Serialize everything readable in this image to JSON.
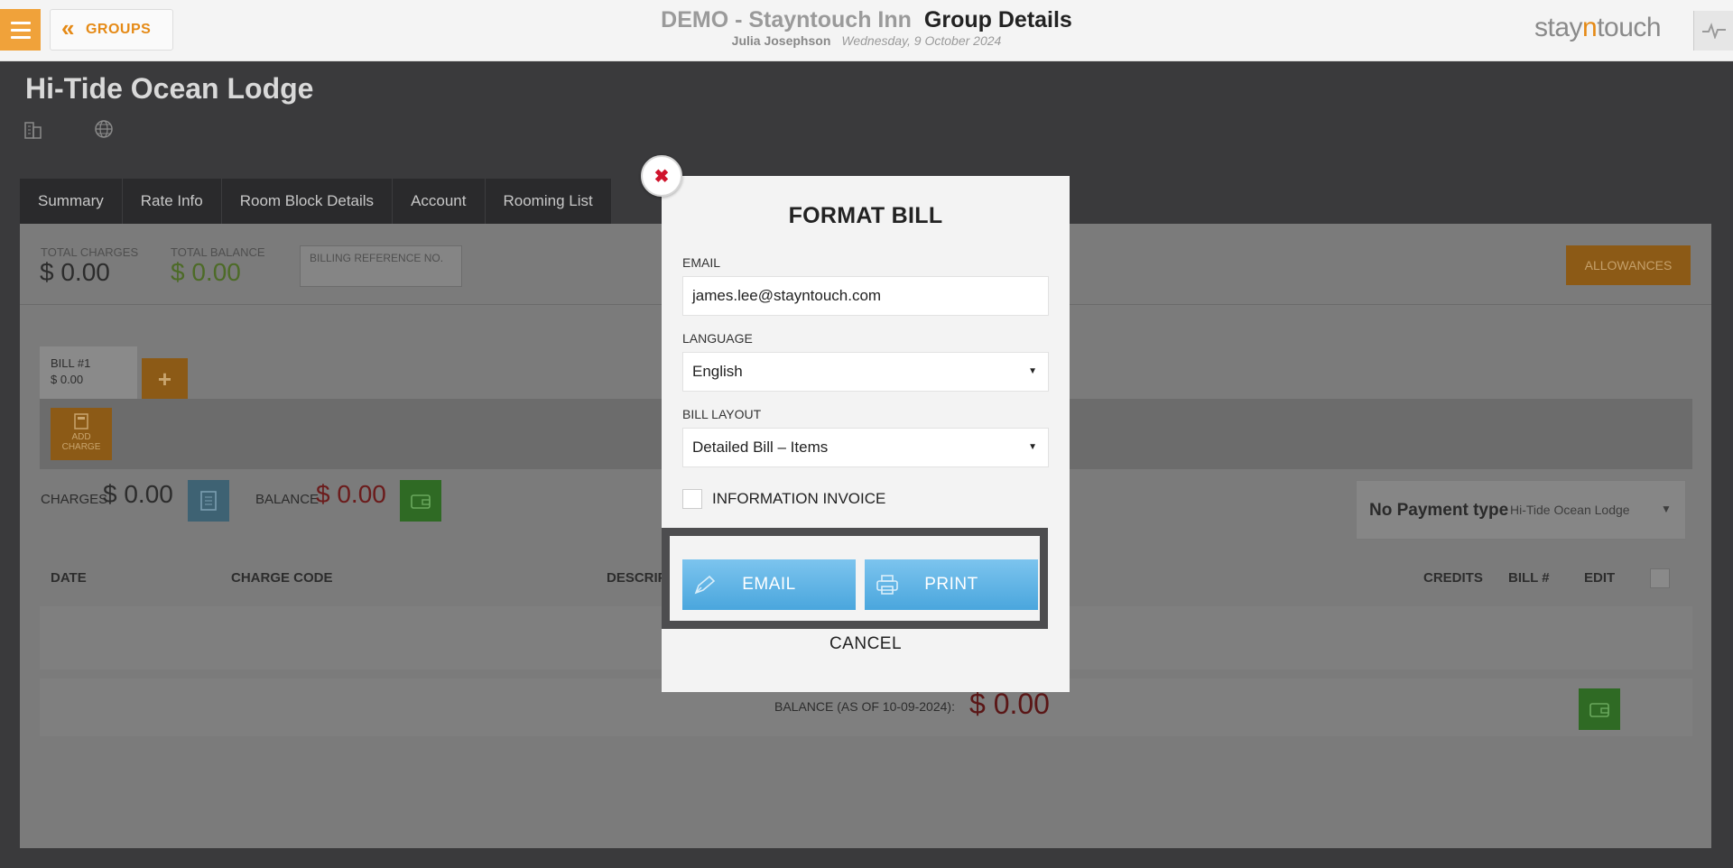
{
  "topbar": {
    "back_label": "GROUPS",
    "hotel_name": "DEMO - Stayntouch Inn",
    "page_title": "Group Details",
    "user_name": "Julia Josephson",
    "date": "Wednesday, 9 October 2024",
    "brand_pre": "stay",
    "brand_accent": "n",
    "brand_post": "touch"
  },
  "group": {
    "name": "Hi-Tide Ocean Lodge"
  },
  "tabs": [
    "Summary",
    "Rate Info",
    "Room Block Details",
    "Account",
    "Rooming List"
  ],
  "account": {
    "total_charges_label": "TOTAL CHARGES",
    "total_charges": "$ 0.00",
    "total_balance_label": "TOTAL BALANCE",
    "total_balance": "$ 0.00",
    "billing_ref_placeholder": "BILLING REFERENCE NO.",
    "allowances_label": "ALLOWANCES",
    "bill_tab_title": "BILL #1",
    "bill_tab_amount": "$ 0.00",
    "add_bill_label": "+",
    "add_charge_label_1": "ADD",
    "add_charge_label_2": "CHARGE",
    "charges_label": "CHARGES",
    "charges_value": "$ 0.00",
    "balance_label": "BALANCE",
    "balance_value": "$ 0.00",
    "payment_type": "No Payment type",
    "payment_account": "Hi-Tide Ocean Lodge",
    "columns": [
      "DATE",
      "CHARGE CODE",
      "DESCRIP",
      "CREDITS",
      "BILL #",
      "EDIT"
    ],
    "balance_asof_label": "BALANCE (AS OF 10-09-2024):",
    "balance_asof_value": "$ 0.00"
  },
  "modal": {
    "title": "FORMAT BILL",
    "email_label": "EMAIL",
    "email_value": "james.lee@stayntouch.com",
    "language_label": "LANGUAGE",
    "language_value": "English",
    "layout_label": "BILL LAYOUT",
    "layout_value": "Detailed Bill – Items",
    "info_invoice_label": "INFORMATION INVOICE",
    "info_invoice_checked": false,
    "email_button": "EMAIL",
    "print_button": "PRINT",
    "cancel_button": "CANCEL",
    "close_icon": "close-icon"
  },
  "colors": {
    "accent_orange": "#f0a23a",
    "button_blue": "#4aa6dd",
    "balance_red": "#d0142c",
    "wallet_green": "#3cb043"
  }
}
